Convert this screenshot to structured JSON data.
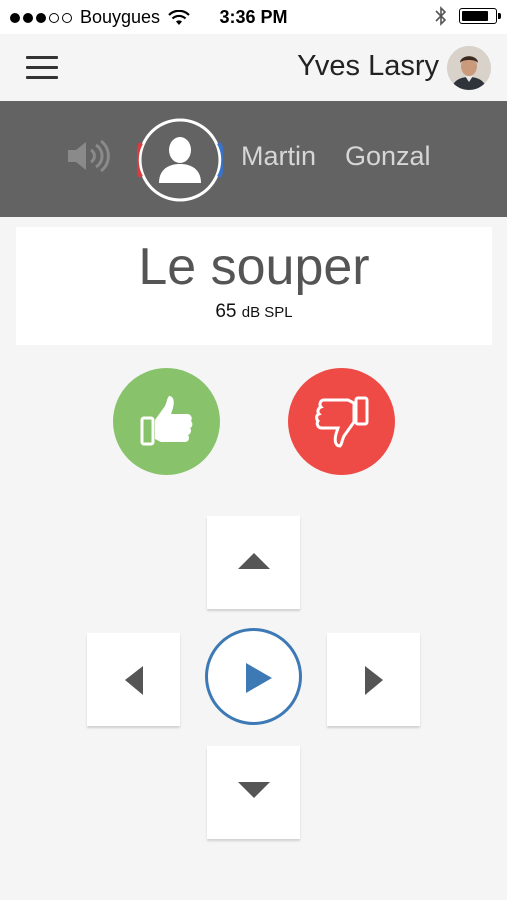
{
  "status_bar": {
    "carrier": "Bouygues",
    "time": "3:36 PM",
    "signal_bars": 3,
    "signal_total": 5,
    "battery_level": 0.85
  },
  "header": {
    "user_name": "Yves Lasry"
  },
  "listeners": {
    "names": [
      "Martin",
      "Gonzal"
    ]
  },
  "track": {
    "title": "Le souper",
    "level_value": "65",
    "level_unit": "dB SPL"
  },
  "colors": {
    "accent_blue": "#3d79b4",
    "like_green": "#88c36b",
    "dislike_red": "#ef4b46",
    "listener_bar": "#636363"
  },
  "icons": {
    "menu": "hamburger-icon",
    "avatar": "user-avatar",
    "volume": "speaker-icon",
    "listener": "person-icon",
    "like": "thumbs-up-icon",
    "dislike": "thumbs-down-icon",
    "up": "triangle-up-icon",
    "down": "triangle-down-icon",
    "left": "triangle-left-icon",
    "right": "triangle-right-icon",
    "play": "play-icon"
  }
}
